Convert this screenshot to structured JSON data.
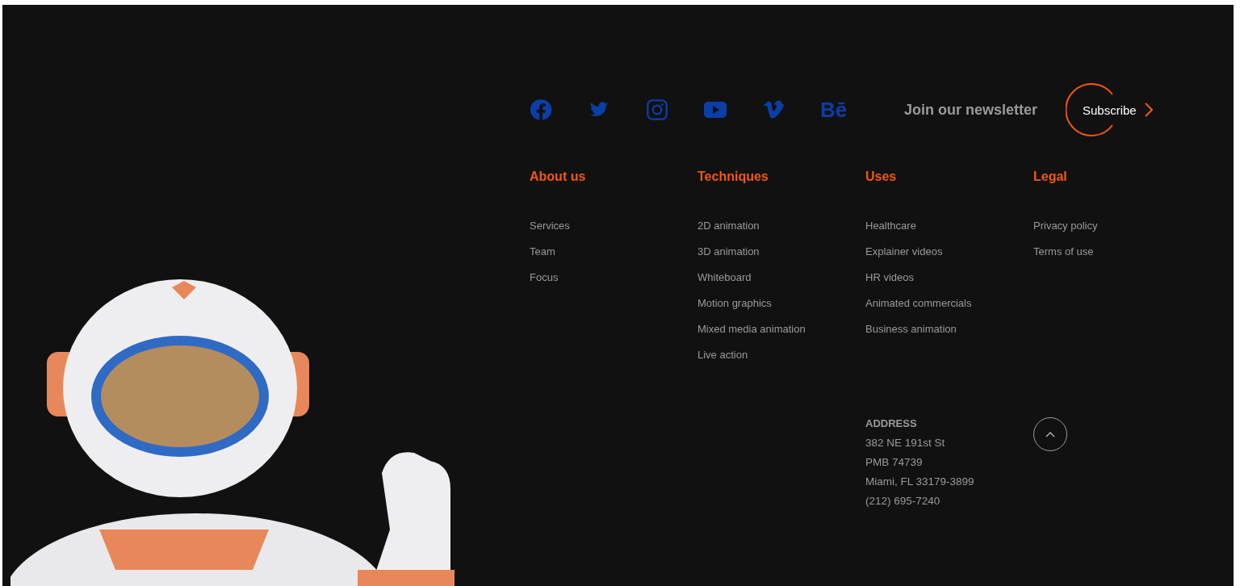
{
  "social": [
    {
      "kind": "facebook"
    },
    {
      "kind": "twitter"
    },
    {
      "kind": "instagram"
    },
    {
      "kind": "youtube"
    },
    {
      "kind": "vimeo"
    },
    {
      "kind": "behance",
      "glyph": "Bē"
    }
  ],
  "newsletter": {
    "label": "Join our newsletter",
    "button": "Subscribe"
  },
  "columns": [
    {
      "heading": "About us",
      "links": [
        "Services",
        "Team",
        "Focus"
      ]
    },
    {
      "heading": "Techniques",
      "links": [
        "2D animation",
        "3D animation",
        "Whiteboard",
        "Motion graphics",
        "Mixed media animation",
        "Live action"
      ]
    },
    {
      "heading": "Uses",
      "links": [
        "Healthcare",
        "Explainer videos",
        "HR videos",
        "Animated commercials",
        "Business animation"
      ]
    },
    {
      "heading": "Legal",
      "links": [
        "Privacy policy",
        "Terms of use"
      ]
    }
  ],
  "address": {
    "heading": "ADDRESS",
    "lines": [
      "382 NE 191st St",
      "PMB 74739",
      "Miami, FL 33179-3899",
      "(212) 695-7240"
    ]
  }
}
